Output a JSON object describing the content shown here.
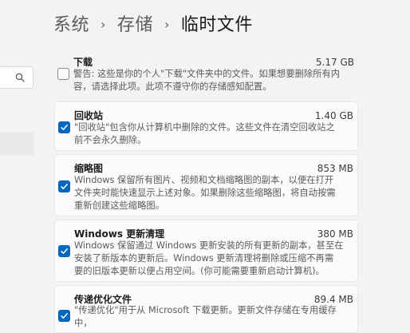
{
  "breadcrumb": {
    "items": [
      "系统",
      "存储",
      "临时文件"
    ],
    "separator": "›"
  },
  "colors": {
    "accent": "#0067c0",
    "background": "#f3f3f3",
    "card": "#fbfbfb"
  },
  "items": [
    {
      "title": "下载",
      "size": "5.17 GB",
      "checked": false,
      "description": "警告: 这些是你的个人\"下载\"文件夹中的文件。如果想要删除所有内\n容，请选择此项。此项不遵守你的存储感知配置。"
    },
    {
      "title": "回收站",
      "size": "1.40 GB",
      "checked": true,
      "description": "\"回收站\"包含你从计算机中删除的文件。这些文件在清空回收站之\n前不会永久删除。"
    },
    {
      "title": "缩略图",
      "size": "853 MB",
      "checked": true,
      "description": "Windows 保留所有图片、视频和文档缩略图的副本，以便在打开\n文件夹时能快速显示上述对象。如果删除这些缩略图，将自动按需\n重新创建这些缩略图。"
    },
    {
      "title": "Windows 更新清理",
      "size": "380 MB",
      "checked": true,
      "description": "Windows 保留通过 Windows 更新安装的所有更新的副本，甚至在\n安装了新版本的更新后。Windows 更新清理将删除或压缩不再需\n要的旧版本更新以便占用空间。(你可能需要重新启动计算机)。"
    },
    {
      "title": "传递优化文件",
      "size": "89.4 MB",
      "checked": true,
      "description": "\"传递优化\"用于从 Microsoft 下载更新。更新文件存储在专用缓存\n中，"
    }
  ]
}
